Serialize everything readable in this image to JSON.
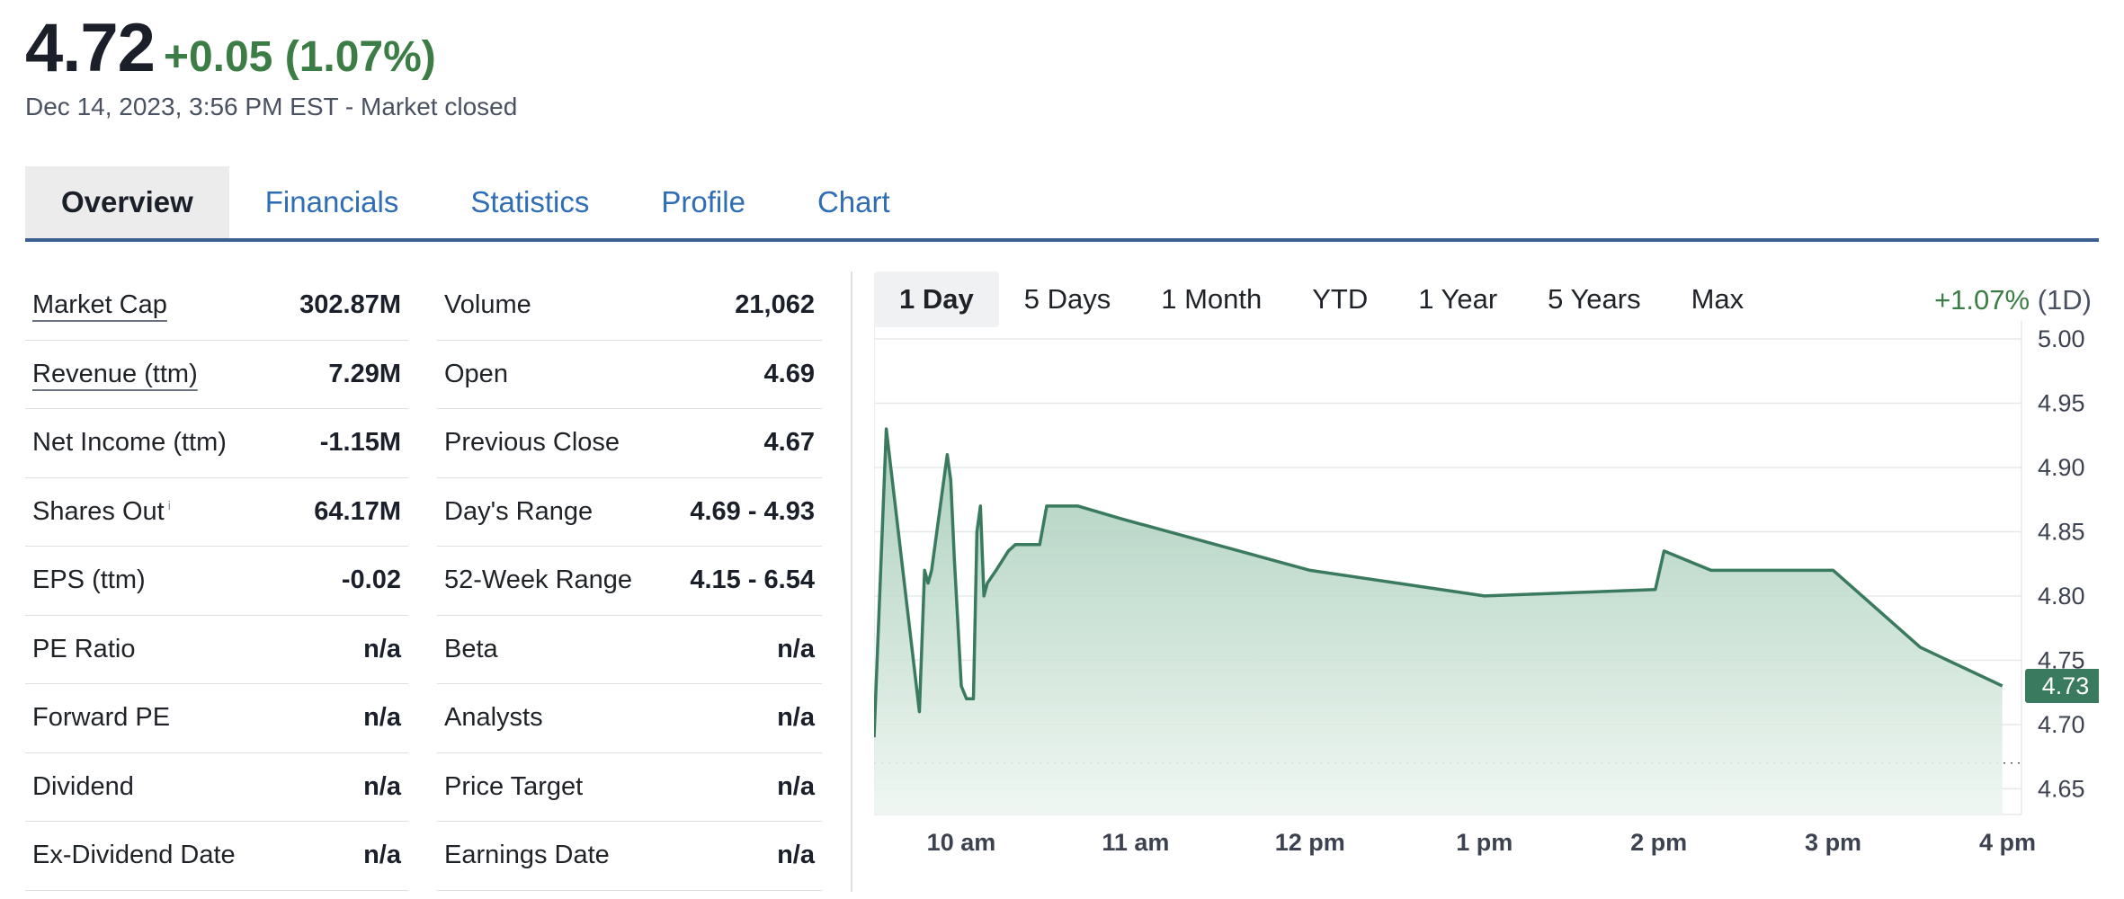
{
  "quote": {
    "price": "4.72",
    "change": "+0.05 (1.07%)",
    "timestamp": "Dec 14, 2023, 3:56 PM EST - Market closed"
  },
  "tabs": [
    {
      "label": "Overview",
      "active": true
    },
    {
      "label": "Financials",
      "active": false
    },
    {
      "label": "Statistics",
      "active": false
    },
    {
      "label": "Profile",
      "active": false
    },
    {
      "label": "Chart",
      "active": false
    }
  ],
  "stats_left": [
    {
      "label": "Market Cap",
      "value": "302.87M",
      "link": true
    },
    {
      "label": "Revenue (ttm)",
      "value": "7.29M",
      "link": true
    },
    {
      "label": "Net Income (ttm)",
      "value": "-1.15M"
    },
    {
      "label": "Shares Out",
      "value": "64.17M",
      "info": "i"
    },
    {
      "label": "EPS (ttm)",
      "value": "-0.02"
    },
    {
      "label": "PE Ratio",
      "value": "n/a"
    },
    {
      "label": "Forward PE",
      "value": "n/a"
    },
    {
      "label": "Dividend",
      "value": "n/a"
    },
    {
      "label": "Ex-Dividend Date",
      "value": "n/a"
    }
  ],
  "stats_right": [
    {
      "label": "Volume",
      "value": "21,062"
    },
    {
      "label": "Open",
      "value": "4.69"
    },
    {
      "label": "Previous Close",
      "value": "4.67"
    },
    {
      "label": "Day's Range",
      "value": "4.69 - 4.93"
    },
    {
      "label": "52-Week Range",
      "value": "4.15 - 6.54"
    },
    {
      "label": "Beta",
      "value": "n/a"
    },
    {
      "label": "Analysts",
      "value": "n/a"
    },
    {
      "label": "Price Target",
      "value": "n/a"
    },
    {
      "label": "Earnings Date",
      "value": "n/a"
    }
  ],
  "chart_controls": {
    "ranges": [
      {
        "label": "1 Day",
        "active": true
      },
      {
        "label": "5 Days",
        "active": false
      },
      {
        "label": "1 Month",
        "active": false
      },
      {
        "label": "YTD",
        "active": false
      },
      {
        "label": "1 Year",
        "active": false
      },
      {
        "label": "5 Years",
        "active": false
      },
      {
        "label": "Max",
        "active": false
      }
    ],
    "performance": "+1.07%",
    "period": "(1D)"
  },
  "colors": {
    "line": "#3a7a5e",
    "fill_top": "#9fc8b3",
    "fill_bottom": "#eef6f1",
    "positive": "#3b7d44",
    "tab_link": "#2f6db5"
  },
  "chart_data": {
    "type": "area",
    "x_unit": "hours (24h clock, Dec 14, 2023)",
    "x": [
      9.5,
      9.57,
      9.76,
      9.79,
      9.81,
      9.83,
      9.92,
      9.94,
      9.96,
      10.0,
      10.03,
      10.07,
      10.09,
      10.11,
      10.13,
      10.15,
      10.2,
      10.27,
      10.31,
      10.45,
      10.49,
      10.59,
      10.67,
      10.92,
      12.0,
      12.5,
      13.0,
      13.98,
      14.03,
      14.3,
      14.71,
      15.0,
      15.5,
      15.97
    ],
    "y": [
      4.69,
      4.93,
      4.71,
      4.82,
      4.81,
      4.82,
      4.91,
      4.89,
      4.83,
      4.73,
      4.72,
      4.72,
      4.85,
      4.87,
      4.8,
      4.81,
      4.82,
      4.835,
      4.84,
      4.84,
      4.87,
      4.87,
      4.87,
      4.86,
      4.82,
      4.81,
      4.8,
      4.805,
      4.835,
      4.82,
      4.82,
      4.82,
      4.76,
      4.73
    ],
    "previous_close": 4.67,
    "last_value": "4.73",
    "ylim": [
      4.63,
      5.0
    ],
    "yticks": [
      "5.00",
      "4.95",
      "4.90",
      "4.85",
      "4.80",
      "4.75",
      "4.70",
      "4.65"
    ],
    "xticks": [
      {
        "value": 10.0,
        "label": "10 am"
      },
      {
        "value": 11.0,
        "label": "11 am"
      },
      {
        "value": 12.0,
        "label": "12 pm"
      },
      {
        "value": 13.0,
        "label": "1 pm"
      },
      {
        "value": 14.0,
        "label": "2 pm"
      },
      {
        "value": 15.0,
        "label": "3 pm"
      },
      {
        "value": 16.0,
        "label": "4 pm"
      }
    ],
    "grid": true
  }
}
